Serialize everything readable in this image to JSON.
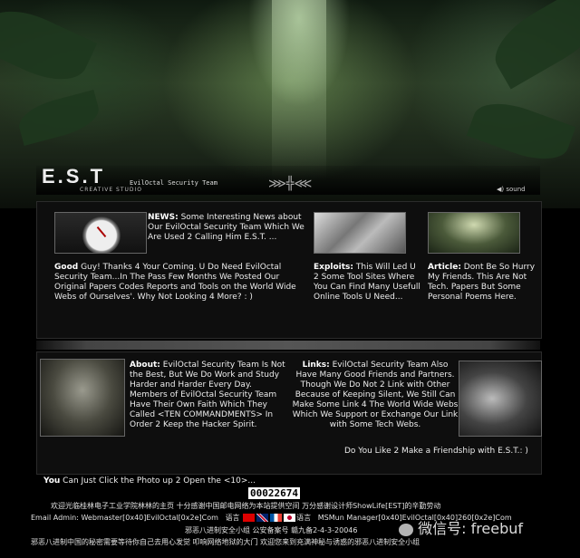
{
  "header": {
    "logo": "E.S.T",
    "logo_sub": "CREATIVE  STUDIO",
    "team": "EvilOctal Security Team",
    "sound": "sound"
  },
  "news": {
    "label": "NEWS:",
    "text": "Some Interesting News about Our EvilOctal Security Team Which We Are Used 2 Calling Him E.S.T. ..."
  },
  "good": {
    "label": "Good",
    "text": "Guy! Thanks 4 Your Coming. U Do Need EvilOctal Security Team...In The Pass Few Months We Posted Our Original Papers Codes Reports and Tools on the World Wide Webs of Ourselves'. Why Not Looking 4 More? : )"
  },
  "exploits": {
    "label": "Exploits:",
    "text": "This Will Led U 2 Some Tool Sites Where You Can Find Many Usefull Online Tools U Need..."
  },
  "article": {
    "label": "Article:",
    "text": "Dont Be So Hurry My Friends. This Are Not Tech. Papers But Some Personal Poems Here."
  },
  "about": {
    "label": "About:",
    "text": "EvilOctal Security Team Is Not the Best, But We Do Work and Study Harder and Harder Every Day. Members of EvilOctal Security Team Have Their Own Faith Which They Called <TEN COMMANDMENTS> In Order 2 Keep the Hacker Spirit."
  },
  "links": {
    "label": "Links:",
    "text": "EvilOctal Security Team Also Have Many Good Friends and Partners. Though We Do Not 2 Link with Other Because of Keeping Silent, We Still Can Make Some Link 4 The World Wide Webs Which We Support or Exchange Our Link with Some Tech Webs."
  },
  "friendship": "Do You Like 2 Make a Friendship with E.S.T.: )",
  "you_click": {
    "label": "You",
    "text": "Can Just Click the Photo up 2 Open the <10>..."
  },
  "counter": "00022674",
  "footer": {
    "line1": "欢迎光临桂林电子工业学院林林的主页  十分感谢中国邮电网络为本站提供空间  万分感谢设计师ShowLife[EST]的辛勤劳动",
    "line2_email": "Email Admin: Webmaster[0x40]EvilOctal[0x2e]Com",
    "line2_lang": "语言",
    "line2_lang2": "语言",
    "line2_msn": "MSMun Manager[0x40]EvilOctal[0x40]260[0x2e]Com",
    "line3": "邪恶八进制安全小组  公安备案号  赣九备2-4-3-20046",
    "line4": "邪恶八进制中国的秘密需要等待你自己去用心发觉  叩响网络地狱的大门  欢迎您来到充满神秘与诱惑的邪恶八进制安全小组",
    "watermark": "微信号: freebuf"
  }
}
